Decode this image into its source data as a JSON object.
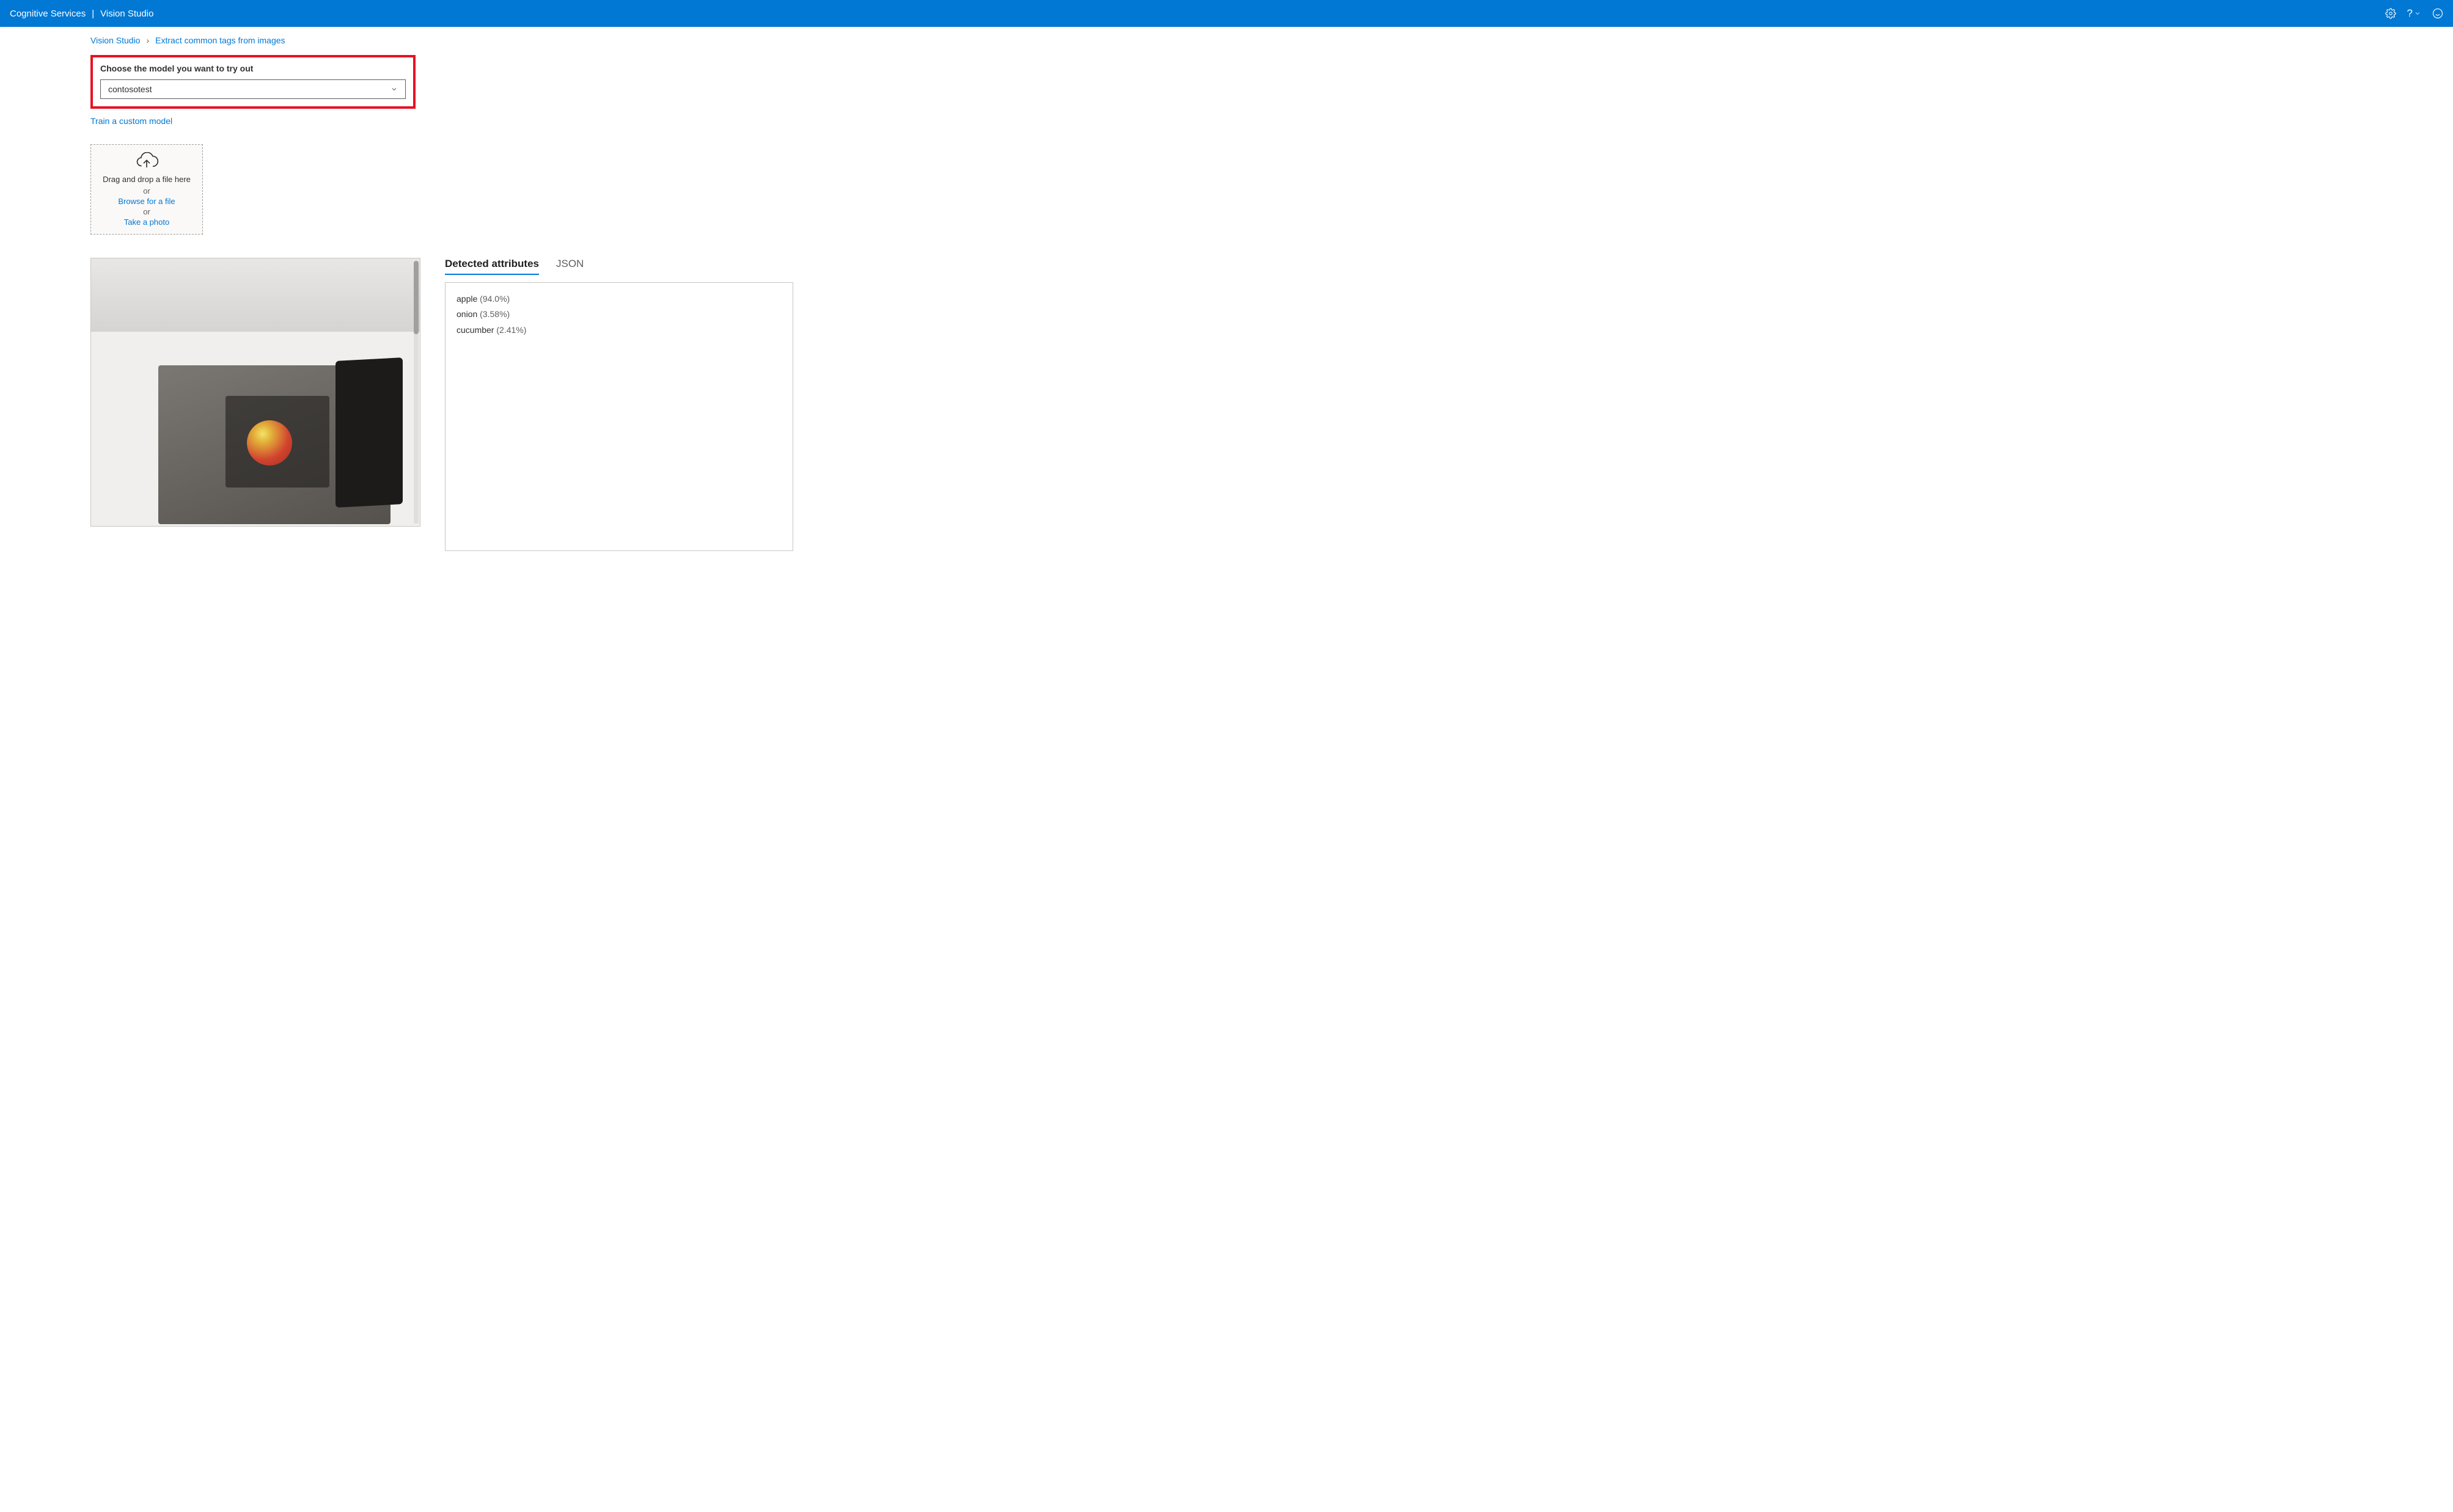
{
  "header": {
    "brand": "Cognitive Services",
    "product": "Vision Studio"
  },
  "breadcrumb": {
    "items": [
      "Vision Studio",
      "Extract common tags from images"
    ]
  },
  "model_selector": {
    "label": "Choose the model you want to try out",
    "value": "contosotest",
    "train_link": "Train a custom model"
  },
  "dropzone": {
    "drag_text": "Drag and drop a file here",
    "or": "or",
    "browse": "Browse for a file",
    "photo": "Take a photo"
  },
  "tabs": {
    "detected": "Detected attributes",
    "json": "JSON"
  },
  "attributes": [
    {
      "label": "apple",
      "confidence": "(94.0%)"
    },
    {
      "label": "onion",
      "confidence": "(3.58%)"
    },
    {
      "label": "cucumber",
      "confidence": "(2.41%)"
    }
  ]
}
